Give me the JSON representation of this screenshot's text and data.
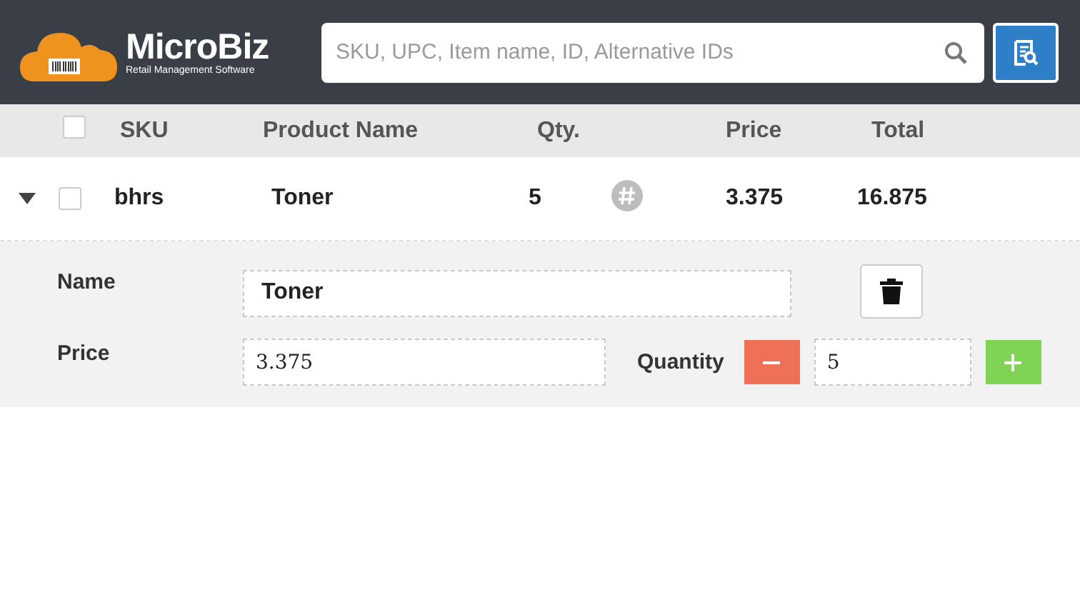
{
  "app": {
    "logo_name": "MicroBiz",
    "logo_tagline": "Retail Management Software"
  },
  "search": {
    "placeholder": "SKU, UPC, Item name, ID, Alternative IDs"
  },
  "table": {
    "columns": [
      "SKU",
      "Product Name",
      "Qty.",
      "Price",
      "Total"
    ],
    "select_all_checked": false,
    "rows": [
      {
        "expanded": true,
        "checked": false,
        "sku": "bhrs",
        "name": "Toner",
        "qty": "5",
        "price": "3.375",
        "total": "16.875"
      }
    ]
  },
  "editor": {
    "name_label": "Name",
    "name_value": "Toner",
    "price_label": "Price",
    "price_value": "3.375",
    "quantity_label": "Quantity",
    "quantity_value": "5"
  }
}
